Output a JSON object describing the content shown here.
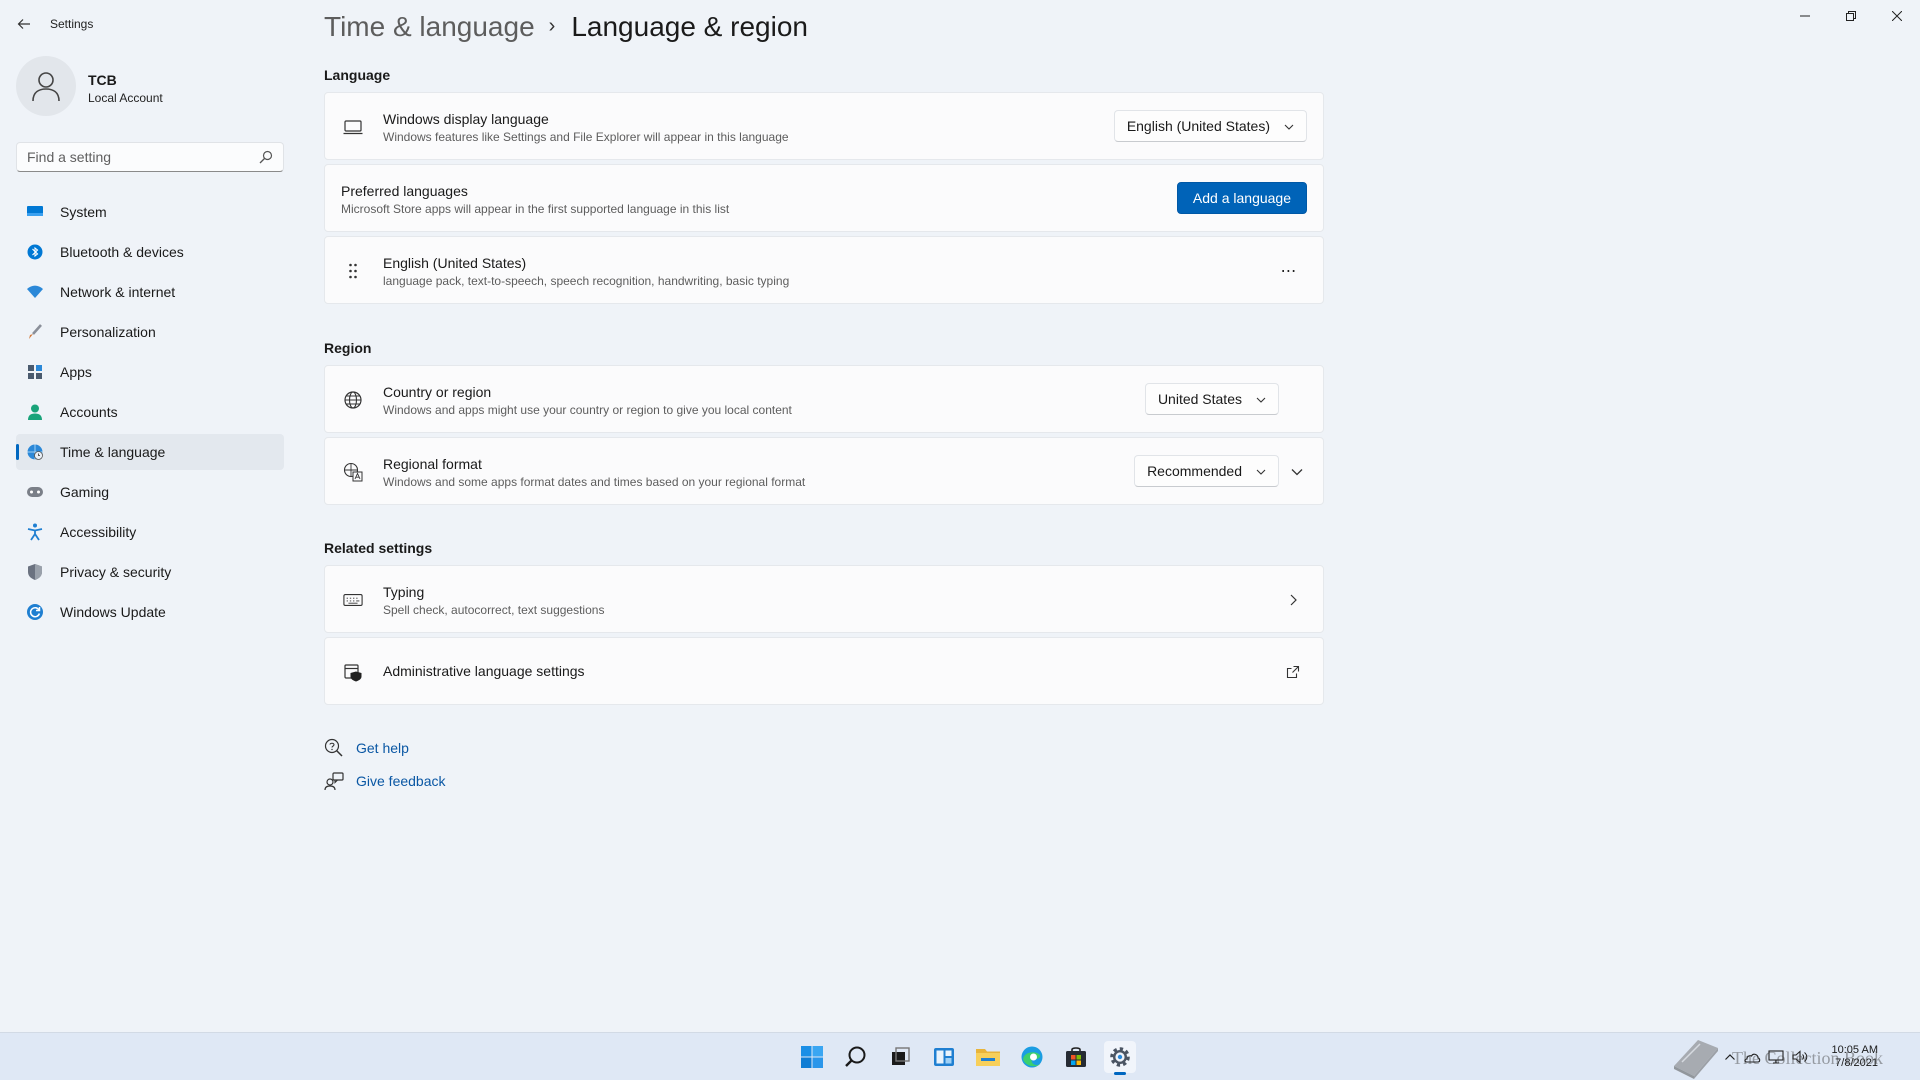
{
  "window": {
    "title": "Settings",
    "controls": {
      "minimize": "minimize",
      "maximize": "restore",
      "close": "close"
    }
  },
  "profile": {
    "name": "TCB",
    "account_type": "Local Account"
  },
  "search": {
    "placeholder": "Find a setting",
    "value": ""
  },
  "sidebar": {
    "items": [
      {
        "label": "System",
        "icon": "system-icon",
        "color": "#0078d4"
      },
      {
        "label": "Bluetooth & devices",
        "icon": "bluetooth-icon",
        "color": "#0078d4"
      },
      {
        "label": "Network & internet",
        "icon": "wifi-icon",
        "color": "#0078d4"
      },
      {
        "label": "Personalization",
        "icon": "brush-icon",
        "color": "#c96d2a"
      },
      {
        "label": "Apps",
        "icon": "apps-icon",
        "color": "#4a5a6e"
      },
      {
        "label": "Accounts",
        "icon": "person-icon",
        "color": "#19a37a"
      },
      {
        "label": "Time & language",
        "icon": "globe-clock-icon",
        "color": "#2b88d8",
        "active": true
      },
      {
        "label": "Gaming",
        "icon": "gamepad-icon",
        "color": "#6b6b6b"
      },
      {
        "label": "Accessibility",
        "icon": "accessibility-icon",
        "color": "#1f7fd1"
      },
      {
        "label": "Privacy & security",
        "icon": "shield-icon",
        "color": "#6b7280"
      },
      {
        "label": "Windows Update",
        "icon": "update-icon",
        "color": "#1f7fd1"
      }
    ]
  },
  "breadcrumb": {
    "parent": "Time & language",
    "separator": "›",
    "current": "Language & region"
  },
  "language": {
    "section_title": "Language",
    "display_language": {
      "title": "Windows display language",
      "subtitle": "Windows features like Settings and File Explorer will appear in this language",
      "value": "English (United States)"
    },
    "preferred": {
      "title": "Preferred languages",
      "subtitle": "Microsoft Store apps will appear in the first supported language in this list",
      "button": "Add a language"
    },
    "installed": [
      {
        "title": "English (United States)",
        "subtitle": "language pack, text-to-speech, speech recognition, handwriting, basic typing",
        "more": "⋯"
      }
    ]
  },
  "region": {
    "section_title": "Region",
    "country": {
      "title": "Country or region",
      "subtitle": "Windows and apps might use your country or region to give you local content",
      "value": "United States"
    },
    "format": {
      "title": "Regional format",
      "subtitle": "Windows and some apps format dates and times based on your regional format",
      "value": "Recommended"
    }
  },
  "related": {
    "section_title": "Related settings",
    "typing": {
      "title": "Typing",
      "subtitle": "Spell check, autocorrect, text suggestions"
    },
    "admin": {
      "title": "Administrative language settings"
    }
  },
  "help": {
    "get_help": "Get help",
    "give_feedback": "Give feedback"
  },
  "taskbar": {
    "icons": [
      "start-icon",
      "search-icon",
      "task-view-icon",
      "widgets-icon",
      "file-explorer-icon",
      "edge-icon",
      "store-icon",
      "settings-icon"
    ],
    "clock": {
      "time": "10:05 AM",
      "date": "7/8/2021"
    },
    "watermark": "The Collection Book"
  },
  "colors": {
    "accent": "#0063b8",
    "link": "#0a57a4",
    "background": "#eff3f8",
    "card": "#fbfbfc"
  }
}
